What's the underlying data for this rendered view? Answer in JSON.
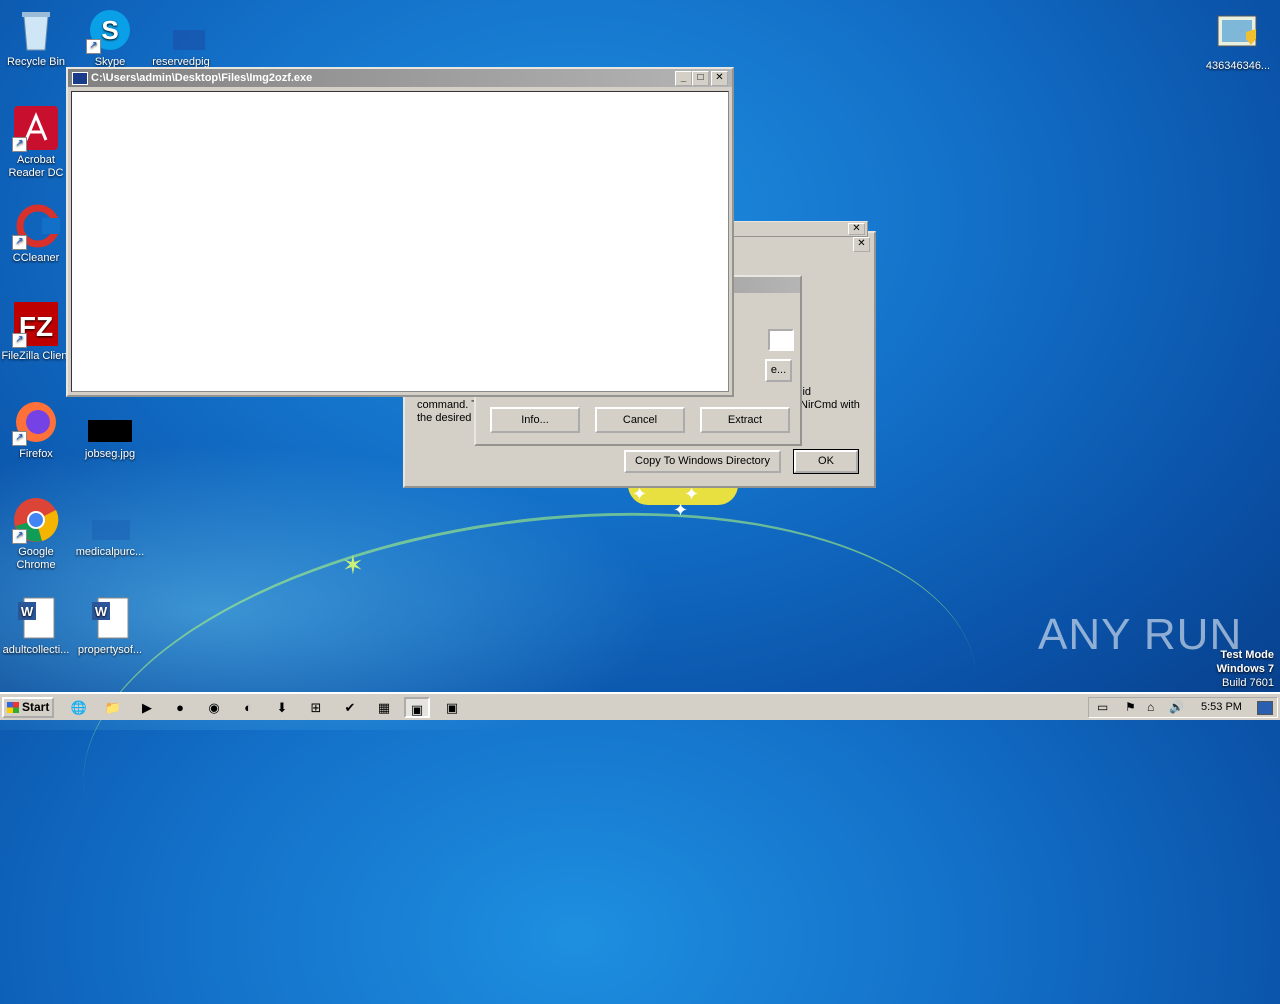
{
  "desktop_icons": {
    "recycle_bin": "Recycle Bin",
    "skype": "Skype",
    "reservedpig": "reservedpig",
    "acrobat": "Acrobat Reader DC",
    "ccleaner": "CCleaner",
    "filezilla": "FileZilla Client",
    "firefox": "Firefox",
    "jobseg": "jobseg.jpg",
    "chrome": "Google Chrome",
    "medicalpurc": "medicalpurc...",
    "adultcollecti": "adultcollecti...",
    "propertysoft": "propertysof...",
    "top_right": "436346346..."
  },
  "main_window": {
    "title": "C:\\Users\\admin\\Desktop\\Files\\Img2ozf.exe"
  },
  "back_dialog": {
    "text_line1": "command. T",
    "text_line2": "the desired c",
    "text_right1": "lid",
    "text_right2": "NirCmd with",
    "browse_partial": "e...",
    "copy_button": "Copy To Windows Directory",
    "ok_button": "OK"
  },
  "mid_dialog": {
    "info_button": "Info...",
    "cancel_button": "Cancel",
    "extract_button": "Extract"
  },
  "watermark": {
    "brand": "ANY RUN",
    "test_mode": "Test Mode",
    "os": "Windows 7",
    "build": "Build 7601"
  },
  "taskbar": {
    "start_label": "Start",
    "clock": "5:53 PM"
  }
}
